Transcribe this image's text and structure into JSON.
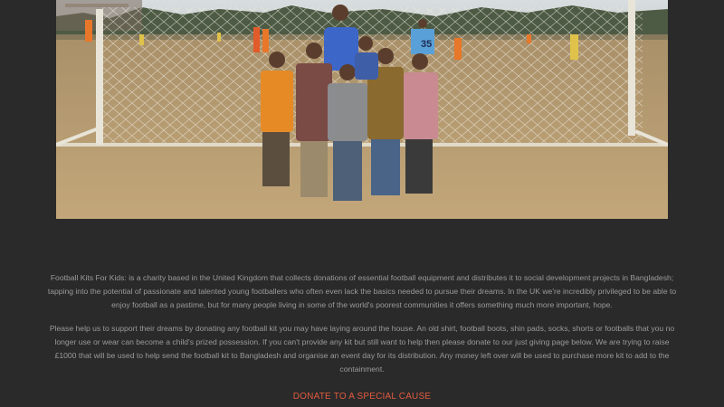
{
  "hero": {
    "alt": "Children standing in front of a football goal on a sandy pitch in Bangladesh",
    "kit_number": "35"
  },
  "content": {
    "paragraph1": "Football Kits For Kids: is a charity based in the United Kingdom that collects donations of essential football equipment and distributes it to social development projects in Bangladesh; tapping into the potential of passionate and talented young footballers who often even lack the basics needed to pursue their dreams. In the UK we're incredibly privileged to be able to enjoy football as a pastime, but for many people living in some of the world's poorest communities it offers something much more important, hope.",
    "paragraph2": "Please help us to support their dreams by donating any football kit you may have laying around the house. An old shirt, football boots, shin pads, socks, shorts or footballs that you no longer use or wear can become a child's prized possession. If you can't provide any kit but still want to help then please donate to our just giving page below. We are trying to raise £1000 that will be used to help send the football kit to Bangladesh and organise an event day for its distribution. Any money left over will be used to purchase more kit to add to the containment.",
    "donate_label": "DONATE TO A SPECIAL CAUSE"
  },
  "colors": {
    "background": "#2a2a2a",
    "text": "#9a9a9a",
    "accent": "#e25a40"
  }
}
